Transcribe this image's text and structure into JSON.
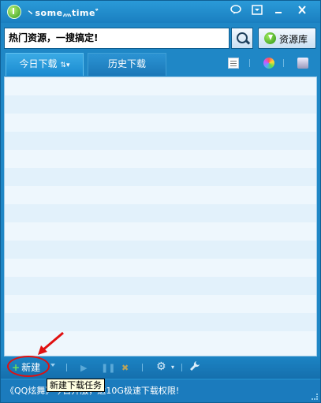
{
  "titlebar": {
    "title": "丶some灬time゛",
    "buttons": [
      "speech-bubble",
      "minimize-to-tray",
      "minimize",
      "close"
    ]
  },
  "search": {
    "value": "热门资源，一搜搞定!",
    "resource_label": "资源库"
  },
  "tabs": [
    {
      "label": "今日下载",
      "sort_symbol": "⇅▾"
    },
    {
      "label": "历史下载"
    }
  ],
  "list": {
    "rows": 15
  },
  "bottom": {
    "new_label": "新建",
    "new_plus": "+",
    "tooltip": "新建下载任务"
  },
  "status": {
    "text": "《QQ炫舞》今日开服，送10G极速下载权限!"
  },
  "colors": {
    "frame": "#1f87c6",
    "list_bg": "#eef7fd",
    "annotation": "#e01010"
  }
}
